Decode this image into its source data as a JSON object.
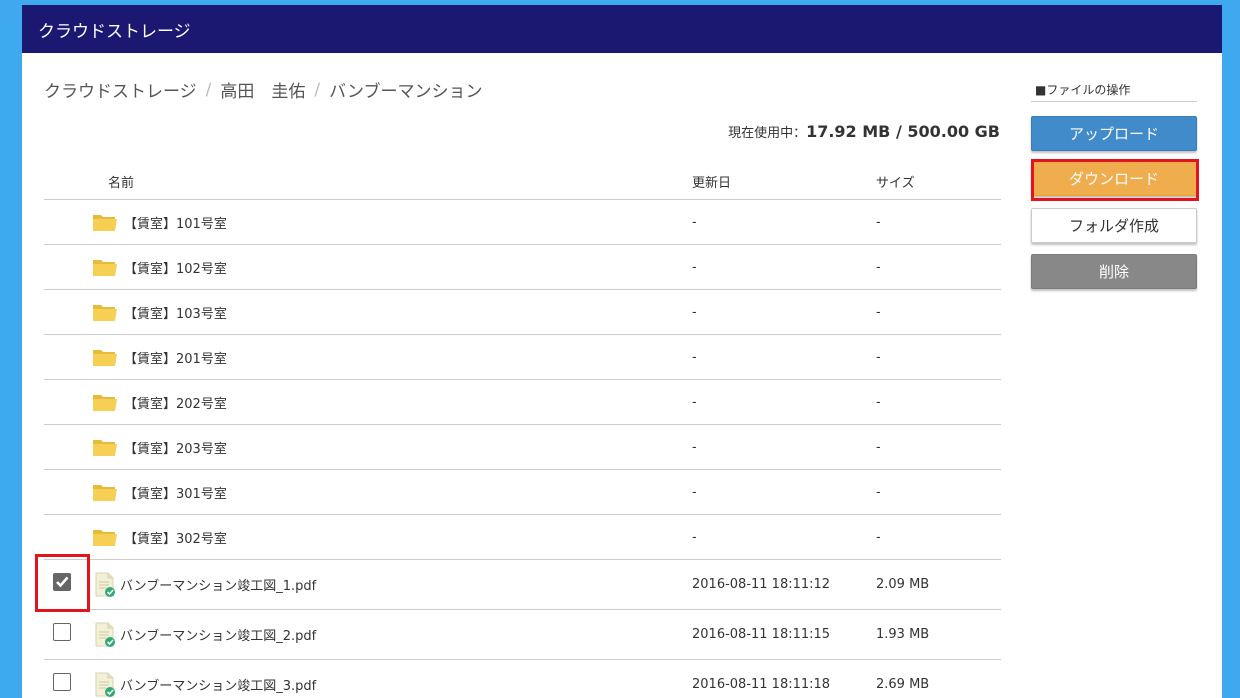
{
  "header": {
    "title": "クラウドストレージ"
  },
  "breadcrumb": {
    "items": [
      "クラウドストレージ",
      "高田　圭佑",
      "バンブーマンション"
    ],
    "separator": "/"
  },
  "usage": {
    "label": "現在使用中：",
    "value": "17.92 MB / 500.00 GB"
  },
  "table": {
    "columns": {
      "name": "名前",
      "date": "更新日",
      "size": "サイズ"
    },
    "folders": [
      {
        "name": "【賃室】101号室",
        "date": "-",
        "size": "-"
      },
      {
        "name": "【賃室】102号室",
        "date": "-",
        "size": "-"
      },
      {
        "name": "【賃室】103号室",
        "date": "-",
        "size": "-"
      },
      {
        "name": "【賃室】201号室",
        "date": "-",
        "size": "-"
      },
      {
        "name": "【賃室】202号室",
        "date": "-",
        "size": "-"
      },
      {
        "name": "【賃室】203号室",
        "date": "-",
        "size": "-"
      },
      {
        "name": "【賃室】301号室",
        "date": "-",
        "size": "-"
      },
      {
        "name": "【賃室】302号室",
        "date": "-",
        "size": "-"
      }
    ],
    "files": [
      {
        "name": "バンブーマンション竣工図_1.pdf",
        "date": "2016-08-11 18:11:12",
        "size": "2.09 MB",
        "checked": true
      },
      {
        "name": "バンブーマンション竣工図_2.pdf",
        "date": "2016-08-11 18:11:15",
        "size": "1.93 MB",
        "checked": false
      },
      {
        "name": "バンブーマンション竣工図_3.pdf",
        "date": "2016-08-11 18:11:18",
        "size": "2.69 MB",
        "checked": false
      }
    ]
  },
  "sidebar": {
    "title": "■ファイルの操作",
    "upload_label": "アップロード",
    "download_label": "ダウンロード",
    "create_folder_label": "フォルダ作成",
    "delete_label": "削除"
  },
  "icons": {
    "folder": "folder-icon",
    "pdf": "pdf-file-icon",
    "check": "checkmark-icon"
  },
  "colors": {
    "header_bg": "#1a1871",
    "page_bg": "#3fa9ef",
    "primary": "#428bca",
    "warning": "#f0ad4e",
    "highlight": "#e3141b"
  }
}
